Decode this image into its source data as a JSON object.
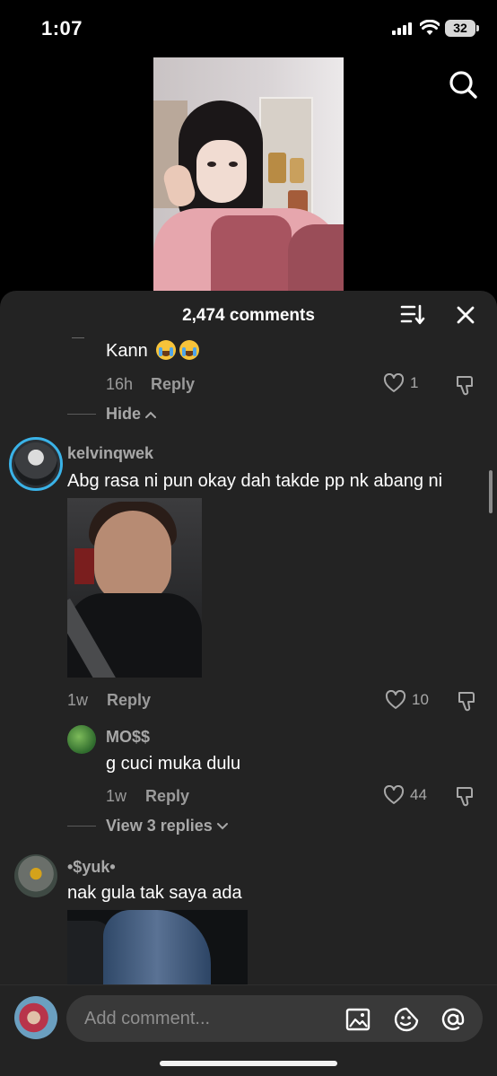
{
  "status": {
    "time": "1:07",
    "battery": "32"
  },
  "sheet": {
    "count_label": "2,474 comments"
  },
  "thread1_reply": {
    "text": "Kann",
    "time": "16h",
    "reply_label": "Reply",
    "likes": "1",
    "emoji": [
      "loudly-crying-face",
      "loudly-crying-face"
    ]
  },
  "hide_label": "Hide",
  "comment1": {
    "username": "kelvinqwek",
    "text": "Abg rasa ni pun okay dah takde pp nk abang ni",
    "time": "1w",
    "reply_label": "Reply",
    "likes": "10"
  },
  "reply1": {
    "username": "MO$$",
    "text": "g cuci muka dulu",
    "time": "1w",
    "reply_label": "Reply",
    "likes": "44"
  },
  "view_replies_label": "View 3 replies",
  "comment2": {
    "username": "•$yuk•",
    "text": "nak gula tak saya ada"
  },
  "composer": {
    "placeholder": "Add comment..."
  },
  "colors": {
    "sheet_bg": "#232323",
    "story_ring": "#3ab3e8",
    "muted": "#9b9b9b"
  }
}
